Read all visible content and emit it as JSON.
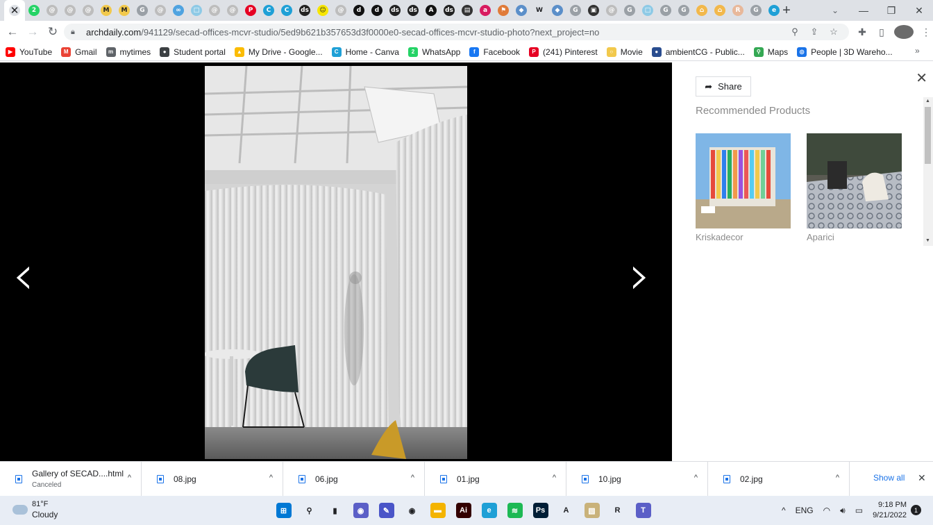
{
  "browser": {
    "tabs": [
      {
        "icon": "close-icon",
        "glyph": "✕",
        "color": "#dee1e6"
      },
      {
        "icon": "whatsapp-icon",
        "glyph": "2",
        "color": "#25d366"
      },
      {
        "icon": "archdaily-icon",
        "glyph": "@",
        "color": "#bdbdbd"
      },
      {
        "icon": "archdaily-icon",
        "glyph": "@",
        "color": "#bdbdbd"
      },
      {
        "icon": "archdaily-icon",
        "glyph": "@",
        "color": "#bdbdbd"
      },
      {
        "icon": "miro-icon",
        "glyph": "M",
        "color": "#f2c94c"
      },
      {
        "icon": "miro-icon",
        "glyph": "M",
        "color": "#f2c94c"
      },
      {
        "icon": "google-icon",
        "glyph": "G",
        "color": "#9aa0a6"
      },
      {
        "icon": "archdaily-icon",
        "glyph": "@",
        "color": "#bdbdbd"
      },
      {
        "icon": "link-icon",
        "glyph": "∞",
        "color": "#4fa3e0"
      },
      {
        "icon": "page-icon",
        "glyph": "□",
        "color": "#8ecae6"
      },
      {
        "icon": "archdaily-icon",
        "glyph": "@",
        "color": "#bdbdbd"
      },
      {
        "icon": "archdaily-icon",
        "glyph": "@",
        "color": "#bdbdbd"
      },
      {
        "icon": "pinterest-icon",
        "glyph": "P",
        "color": "#e60023"
      },
      {
        "icon": "canva-icon",
        "glyph": "C",
        "color": "#1fa0d6"
      },
      {
        "icon": "canva-icon",
        "glyph": "C",
        "color": "#1fa0d6"
      },
      {
        "icon": "ds-icon",
        "glyph": "ds",
        "color": "#222222"
      },
      {
        "icon": "snapchat-icon",
        "glyph": "☺",
        "color": "#f7e600"
      },
      {
        "icon": "archdaily-icon",
        "glyph": "@",
        "color": "#bdbdbd"
      },
      {
        "icon": "d-icon",
        "glyph": "d",
        "color": "#111111"
      },
      {
        "icon": "d-icon",
        "glyph": "d",
        "color": "#111111"
      },
      {
        "icon": "ds-icon",
        "glyph": "ds",
        "color": "#222222"
      },
      {
        "icon": "ds-icon",
        "glyph": "ds",
        "color": "#222222"
      },
      {
        "icon": "a-icon",
        "glyph": "A",
        "color": "#111111"
      },
      {
        "icon": "ds-icon",
        "glyph": "ds",
        "color": "#222222"
      },
      {
        "icon": "arch-icon",
        "glyph": "▤",
        "color": "#333333"
      },
      {
        "icon": "a-red-icon",
        "glyph": "a",
        "color": "#d81b60"
      },
      {
        "icon": "flag-icon",
        "glyph": "⚑",
        "color": "#e07b39"
      },
      {
        "icon": "cube-icon",
        "glyph": "◆",
        "color": "#5b8fc9"
      },
      {
        "icon": "wikipedia-icon",
        "glyph": "W",
        "color": "#dee1e6"
      },
      {
        "icon": "cube-icon",
        "glyph": "◆",
        "color": "#5b8fc9"
      },
      {
        "icon": "google-icon",
        "glyph": "G",
        "color": "#9aa0a6"
      },
      {
        "icon": "photo-icon",
        "glyph": "▣",
        "color": "#333333"
      },
      {
        "icon": "archdaily-icon",
        "glyph": "@",
        "color": "#bdbdbd"
      },
      {
        "icon": "google-icon",
        "glyph": "G",
        "color": "#9aa0a6"
      },
      {
        "icon": "page-icon",
        "glyph": "□",
        "color": "#8ecae6"
      },
      {
        "icon": "google-icon",
        "glyph": "G",
        "color": "#9aa0a6"
      },
      {
        "icon": "google-icon",
        "glyph": "G",
        "color": "#9aa0a6"
      },
      {
        "icon": "home-icon",
        "glyph": "⌂",
        "color": "#f2b84b"
      },
      {
        "icon": "home-icon",
        "glyph": "⌂",
        "color": "#f2b84b"
      },
      {
        "icon": "rs-icon",
        "glyph": "R",
        "color": "#e8b89a"
      },
      {
        "icon": "google-icon",
        "glyph": "G",
        "color": "#9aa0a6"
      },
      {
        "icon": "edge-icon",
        "glyph": "e",
        "color": "#1fa0d6"
      }
    ],
    "new_tab_label": "+",
    "url_domain": "archdaily.com",
    "url_path": "/941129/secad-offices-mcvr-studio/5ed9b621b357653d3f0000e0-secad-offices-mcvr-studio-photo?next_project=no",
    "bookmarks": [
      {
        "label": "YouTube",
        "icon": "youtube-icon",
        "color": "#ff0000",
        "glyph": "▶"
      },
      {
        "label": "Gmail",
        "icon": "gmail-icon",
        "color": "#ea4335",
        "glyph": "M"
      },
      {
        "label": "mytimes",
        "icon": "mytimes-icon",
        "color": "#5f6368",
        "glyph": "m"
      },
      {
        "label": "Student portal",
        "icon": "globe-icon",
        "color": "#3c4043",
        "glyph": "●"
      },
      {
        "label": "My Drive - Google...",
        "icon": "drive-icon",
        "color": "#fbbc04",
        "glyph": "▲"
      },
      {
        "label": "Home - Canva",
        "icon": "canva-icon",
        "color": "#1fa0d6",
        "glyph": "C"
      },
      {
        "label": "WhatsApp",
        "icon": "whatsapp-icon",
        "color": "#25d366",
        "glyph": "2"
      },
      {
        "label": "Facebook",
        "icon": "facebook-icon",
        "color": "#1877f2",
        "glyph": "f"
      },
      {
        "label": "(241) Pinterest",
        "icon": "pinterest-icon",
        "color": "#e60023",
        "glyph": "P"
      },
      {
        "label": "Movie",
        "icon": "movie-icon",
        "color": "#f2c94c",
        "glyph": "○"
      },
      {
        "label": "ambientCG - Public...",
        "icon": "ambientcg-icon",
        "color": "#2a4d8f",
        "glyph": "●"
      },
      {
        "label": "Maps",
        "icon": "maps-icon",
        "color": "#34a853",
        "glyph": "⚲"
      },
      {
        "label": "People | 3D Wareho...",
        "icon": "sketchup-icon",
        "color": "#1a73e8",
        "glyph": "◎"
      }
    ],
    "bookmarks_more": "»"
  },
  "viewer": {
    "prev_arrow": "‹",
    "next_arrow": "›"
  },
  "sidebar": {
    "share_label": "Share",
    "close_label": "✕",
    "recommended_title": "Recommended Products",
    "products": [
      {
        "name": "Kriskadecor"
      },
      {
        "name": "Aparici"
      }
    ]
  },
  "downloads": {
    "items": [
      {
        "name": "Gallery of SECAD....html",
        "status": "Canceled"
      },
      {
        "name": "08.jpg",
        "status": ""
      },
      {
        "name": "06.jpg",
        "status": ""
      },
      {
        "name": "01.jpg",
        "status": ""
      },
      {
        "name": "10.jpg",
        "status": ""
      },
      {
        "name": "02.jpg",
        "status": ""
      }
    ],
    "show_all": "Show all",
    "close_label": "✕"
  },
  "taskbar": {
    "temperature": "81°F",
    "weather": "Cloudy",
    "apps": [
      {
        "icon": "windows-start-icon",
        "color": "#0078d4",
        "glyph": "⊞"
      },
      {
        "icon": "search-icon",
        "color": "#e8edf5",
        "glyph": "⚲"
      },
      {
        "icon": "task-view-icon",
        "color": "#e8edf5",
        "glyph": "▮"
      },
      {
        "icon": "chat-icon",
        "color": "#5b5fc7",
        "glyph": "◉"
      },
      {
        "icon": "pen-app-icon",
        "color": "#4a55c8",
        "glyph": "✎"
      },
      {
        "icon": "chrome-icon",
        "color": "#e8edf5",
        "glyph": "◉"
      },
      {
        "icon": "file-explorer-icon",
        "color": "#f4b400",
        "glyph": "▬"
      },
      {
        "icon": "illustrator-icon",
        "color": "#330000",
        "glyph": "Ai"
      },
      {
        "icon": "edge-icon",
        "color": "#1fa0d6",
        "glyph": "e"
      },
      {
        "icon": "spotify-icon",
        "color": "#1db954",
        "glyph": "≋"
      },
      {
        "icon": "photoshop-icon",
        "color": "#001e36",
        "glyph": "Ps"
      },
      {
        "icon": "acrobat-icon",
        "color": "#e8edf5",
        "glyph": "A"
      },
      {
        "icon": "image-app-icon",
        "color": "#c9b27a",
        "glyph": "▧"
      },
      {
        "icon": "revit-icon",
        "color": "#e8edf5",
        "glyph": "R"
      },
      {
        "icon": "teams-icon",
        "color": "#5b5fc7",
        "glyph": "T"
      }
    ],
    "chevron": "^",
    "language": "ENG",
    "time": "9:18 PM",
    "date": "9/21/2022",
    "notifications": "1"
  }
}
